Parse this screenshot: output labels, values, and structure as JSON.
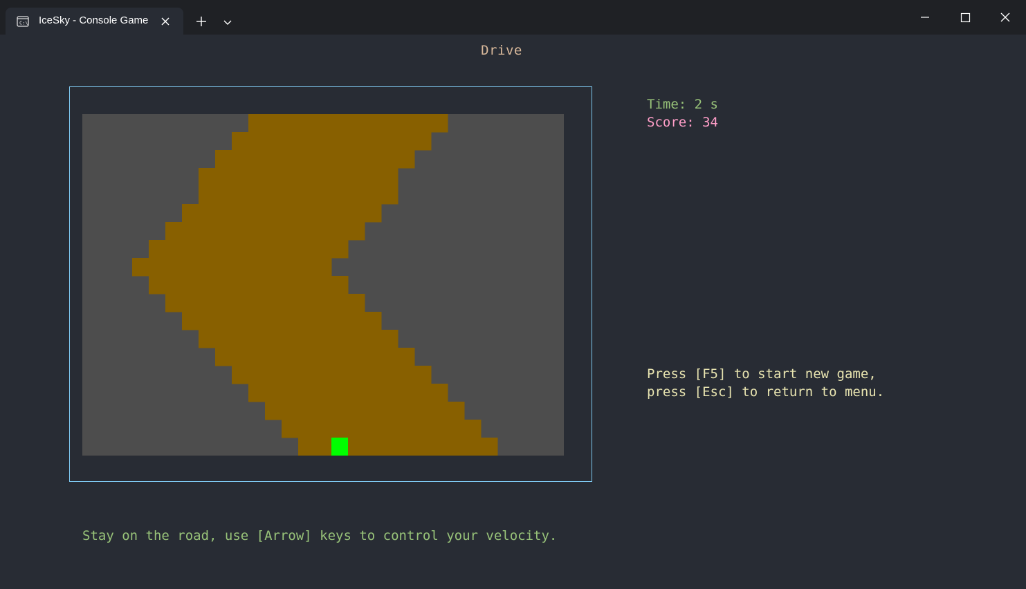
{
  "window": {
    "tab_title": "IceSky - Console Game",
    "tab_icon": "terminal-icon"
  },
  "game": {
    "title": "Drive",
    "time_text": "Time: 2 s",
    "score_text": "Score: 34",
    "message_line1": "Press [F5] to start new game,",
    "message_line2": "press [Esc] to return to menu.",
    "instructions": "Stay on the road, use [Arrow] keys to control your velocity."
  },
  "grid": {
    "columns": 29,
    "rows": 19,
    "road_spans": [
      [
        10,
        21
      ],
      [
        9,
        20
      ],
      [
        8,
        19
      ],
      [
        7,
        18
      ],
      [
        7,
        18
      ],
      [
        6,
        17
      ],
      [
        5,
        16
      ],
      [
        4,
        15
      ],
      [
        3,
        14
      ],
      [
        4,
        15
      ],
      [
        5,
        16
      ],
      [
        6,
        17
      ],
      [
        7,
        18
      ],
      [
        8,
        19
      ],
      [
        9,
        20
      ],
      [
        10,
        21
      ],
      [
        11,
        22
      ],
      [
        12,
        23
      ],
      [
        13,
        24
      ]
    ],
    "car_column": 15,
    "car_row": 18
  },
  "colors": {
    "background": "#282c34",
    "ground": "#4d4d4d",
    "road": "#886000",
    "car": "#00ff00",
    "frame": "#7ec8f0"
  }
}
